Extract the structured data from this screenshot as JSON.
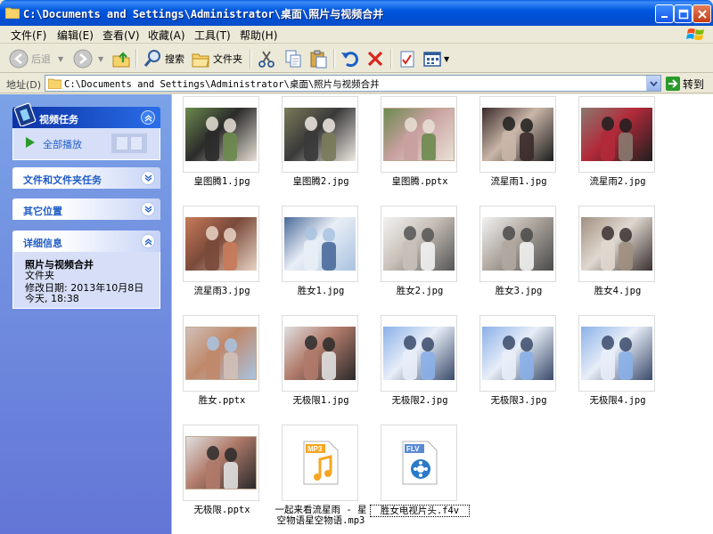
{
  "window": {
    "title": "C:\\Documents and Settings\\Administrator\\桌面\\照片与视频合并"
  },
  "menu": [
    "文件(F)",
    "编辑(E)",
    "查看(V)",
    "收藏(A)",
    "工具(T)",
    "帮助(H)"
  ],
  "toolbar": {
    "back": "后退",
    "search": "搜索",
    "folders": "文件夹"
  },
  "address": {
    "label": "地址(D)",
    "value": "C:\\Documents and Settings\\Administrator\\桌面\\照片与视频合并",
    "go": "转到"
  },
  "leftpane": {
    "video_tasks": {
      "title": "视频任务",
      "play_all": "全部播放"
    },
    "file_tasks": {
      "title": "文件和文件夹任务"
    },
    "other_places": {
      "title": "其它位置"
    },
    "details": {
      "title": "详细信息",
      "name": "照片与视频合并",
      "type": "文件夹",
      "modified": "修改日期: 2013年10月8日",
      "today": "今天, 18:38"
    }
  },
  "files": [
    {
      "name": "皇图腾1.jpg",
      "kind": "photo",
      "palette": [
        "#6b8a4e",
        "#e8e0d6",
        "#2b2b2b"
      ]
    },
    {
      "name": "皇图腾2.jpg",
      "kind": "photo",
      "palette": [
        "#7a7a5a",
        "#efe9e2",
        "#3a3a3a"
      ]
    },
    {
      "name": "皇图腾.pptx",
      "kind": "slide",
      "palette": [
        "#6b8a4e",
        "#e8e0d6",
        "#c8a0a0"
      ]
    },
    {
      "name": "流星雨1.jpg",
      "kind": "photo",
      "palette": [
        "#3a2a2a",
        "#1d1d1d",
        "#c9b6a8"
      ]
    },
    {
      "name": "流星雨2.jpg",
      "kind": "photo",
      "palette": [
        "#8a7a70",
        "#1f1f1f",
        "#b22a3a"
      ]
    },
    {
      "name": "流星雨3.jpg",
      "kind": "photo",
      "palette": [
        "#c87a5a",
        "#e9d4c4",
        "#7a4a3a"
      ]
    },
    {
      "name": "胜女1.jpg",
      "kind": "photo",
      "palette": [
        "#4a6a9a",
        "#a9c3e0",
        "#e9eef6"
      ]
    },
    {
      "name": "胜女2.jpg",
      "kind": "photo",
      "palette": [
        "#f2f2f2",
        "#555555",
        "#c8c0b8"
      ]
    },
    {
      "name": "胜女3.jpg",
      "kind": "photo",
      "palette": [
        "#f2f2f2",
        "#4a4a4a",
        "#b0a8a0"
      ]
    },
    {
      "name": "胜女4.jpg",
      "kind": "photo",
      "palette": [
        "#a09080",
        "#3a3030",
        "#e0d8d0"
      ]
    },
    {
      "name": "胜女.pptx",
      "kind": "slide",
      "palette": [
        "#d0c0b8",
        "#a9c3e0",
        "#c0886a"
      ]
    },
    {
      "name": "无极限1.jpg",
      "kind": "photo",
      "palette": [
        "#e0e0e0",
        "#2a2a2a",
        "#b07a6a"
      ]
    },
    {
      "name": "无极限2.jpg",
      "kind": "photo",
      "palette": [
        "#8ab0e8",
        "#3a4a6a",
        "#e8eef8"
      ]
    },
    {
      "name": "无极限3.jpg",
      "kind": "photo",
      "palette": [
        "#8ab0e8",
        "#3a4a6a",
        "#e8eef8"
      ]
    },
    {
      "name": "无极限4.jpg",
      "kind": "photo",
      "palette": [
        "#8ab0e8",
        "#3a4a6a",
        "#e8eef8"
      ]
    },
    {
      "name": "无极限.pptx",
      "kind": "slide",
      "palette": [
        "#e0e0e0",
        "#2a2a2a",
        "#b07a6a"
      ]
    },
    {
      "name": "一起来看流星雨 - 星空物语星空物语.mp3",
      "kind": "mp3",
      "palette": [
        "#f5a623",
        "#ffffff",
        "#d0d0d0"
      ]
    },
    {
      "name": "胜女电视片头.f4v",
      "kind": "flv",
      "palette": [
        "#2a7ac8",
        "#ffffff",
        "#d0d0d0"
      ]
    }
  ],
  "colors": {
    "titlebar": "#0058e0",
    "leftpane": "#6375d6",
    "panel_link": "#215dc6"
  }
}
